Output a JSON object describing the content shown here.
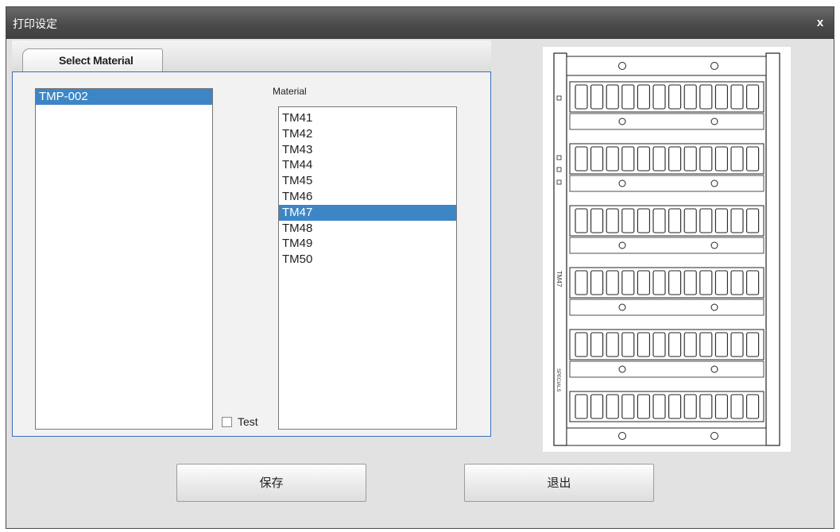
{
  "window": {
    "title": "打印设定",
    "close_label": "x"
  },
  "tabs": [
    {
      "label": "Select Material",
      "active": true
    }
  ],
  "templates": {
    "items": [
      "TMP-002"
    ],
    "selected": "TMP-002"
  },
  "materials": {
    "label": "Material",
    "items": [
      "TM41",
      "TM42",
      "TM43",
      "TM44",
      "TM45",
      "TM46",
      "TM47",
      "TM48",
      "TM49",
      "TM50"
    ],
    "selected": "TM47"
  },
  "test_checkbox": {
    "label": "Test",
    "checked": false
  },
  "preview": {
    "side_text_1": "TM47",
    "side_text_2": "SPECIALS"
  },
  "buttons": {
    "save_label": "保存",
    "exit_label": "退出"
  },
  "colors": {
    "selection": "#3d86c6",
    "titlebar": "#4b4b4b",
    "panel_border": "#3d6fb6"
  }
}
